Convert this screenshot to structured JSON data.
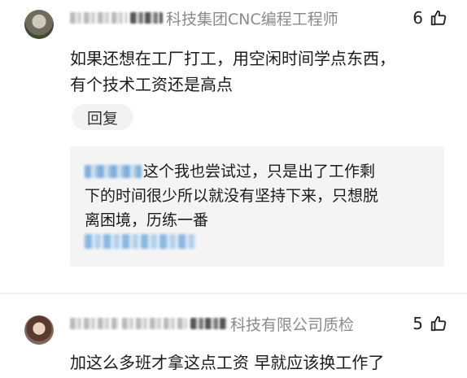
{
  "comments": [
    {
      "title_suffix": "科技集团CNC编程工程师",
      "likes": "6",
      "text_line1": "如果还想在工厂打工，用空闲时间学点东西，",
      "text_line2": "有个技术工资还是高点",
      "reply_label": "回复",
      "reply": {
        "line1": "这个我也尝试过，只是出了工作剩",
        "line2": "下的时间很少所以就没有坚持下来，只想脱",
        "line3": "离困境，历练一番"
      }
    },
    {
      "title_suffix": "科技有限公司质检",
      "likes": "5",
      "text_line1": "加这么多班才拿这点工资 早就应该换工作了"
    }
  ],
  "icons": {
    "like": "thumbs-up-icon"
  },
  "colors": {
    "meta_text": "#8a8a8a",
    "reply_bg": "#f4f4f4",
    "link_blue": "#3a7dc4"
  }
}
